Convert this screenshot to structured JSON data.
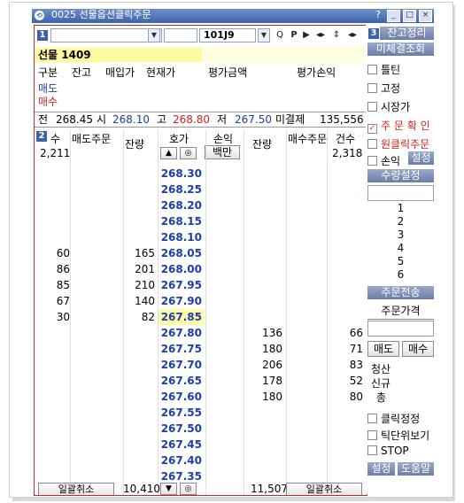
{
  "window": {
    "title": "0025 선물옵션클릭주문",
    "help_icon": "?"
  },
  "toolbar": {
    "panel_number": "1",
    "code": "101J9",
    "search_icon": "Q",
    "p_label": "P"
  },
  "contract": {
    "name": "선물 1409"
  },
  "positions": {
    "headers": [
      "구분",
      "잔고",
      "매입가",
      "현재가",
      "평가금액",
      "평가손익"
    ],
    "rows": [
      "매도",
      "매수"
    ]
  },
  "summary": {
    "open_label": "전",
    "open": "268.45",
    "start_label": "시",
    "start": "268.10",
    "high_label": "고",
    "high": "268.80",
    "low_label": "저",
    "low": "267.50",
    "oi_label": "미결제",
    "oi": "135,556"
  },
  "ladder_header": {
    "panel_number": "2",
    "count_label": "수",
    "sell_order_label": "매도주문",
    "sell_qty_label": "잔량",
    "price_label": "호가",
    "pl_label": "손익",
    "pl_btn": "백만",
    "buy_qty_label": "잔량",
    "buy_order_label": "매수주문",
    "buy_count_label": "건수",
    "sell_count_total": "2,211",
    "buy_count_total": "2,318",
    "up_arrow": "▲",
    "center_btn": "◎"
  },
  "ladder": [
    {
      "count": "",
      "qty": "",
      "price": "268.30",
      "bqty": "",
      "bcount": ""
    },
    {
      "count": "",
      "qty": "",
      "price": "268.25",
      "bqty": "",
      "bcount": ""
    },
    {
      "count": "",
      "qty": "",
      "price": "268.20",
      "bqty": "",
      "bcount": ""
    },
    {
      "count": "",
      "qty": "",
      "price": "268.15",
      "bqty": "",
      "bcount": ""
    },
    {
      "count": "",
      "qty": "",
      "price": "268.10",
      "bqty": "",
      "bcount": ""
    },
    {
      "count": "60",
      "qty": "165",
      "price": "268.05",
      "bqty": "",
      "bcount": ""
    },
    {
      "count": "86",
      "qty": "201",
      "price": "268.00",
      "bqty": "",
      "bcount": ""
    },
    {
      "count": "85",
      "qty": "210",
      "price": "267.95",
      "bqty": "",
      "bcount": ""
    },
    {
      "count": "67",
      "qty": "140",
      "price": "267.90",
      "bqty": "",
      "bcount": ""
    },
    {
      "count": "30",
      "qty": "82",
      "price": "267.85",
      "bqty": "",
      "bcount": ""
    },
    {
      "count": "",
      "qty": "",
      "price": "267.80",
      "bqty": "136",
      "bcount": "66"
    },
    {
      "count": "",
      "qty": "",
      "price": "267.75",
      "bqty": "180",
      "bcount": "71"
    },
    {
      "count": "",
      "qty": "",
      "price": "267.70",
      "bqty": "206",
      "bcount": "83"
    },
    {
      "count": "",
      "qty": "",
      "price": "267.65",
      "bqty": "178",
      "bcount": "52"
    },
    {
      "count": "",
      "qty": "",
      "price": "267.60",
      "bqty": "180",
      "bcount": "80"
    },
    {
      "count": "",
      "qty": "",
      "price": "267.55",
      "bqty": "",
      "bcount": ""
    },
    {
      "count": "",
      "qty": "",
      "price": "267.50",
      "bqty": "",
      "bcount": ""
    },
    {
      "count": "",
      "qty": "",
      "price": "267.45",
      "bqty": "",
      "bcount": ""
    },
    {
      "count": "",
      "qty": "",
      "price": "267.40",
      "bqty": "",
      "bcount": ""
    },
    {
      "count": "",
      "qty": "",
      "price": "267.35",
      "bqty": "",
      "bcount": ""
    }
  ],
  "footer": {
    "sell_all_btn": "일괄취소",
    "sell_total": "10,410",
    "down_arrow": "▼",
    "center_btn": "◎",
    "buy_total": "11,507",
    "buy_all_btn": "일괄취소"
  },
  "right_panel": {
    "panel_number": "3",
    "balance_btn": "잔고정리",
    "unfilled_btn": "미체결조회",
    "options": [
      {
        "label": "틀틴",
        "checked": false
      },
      {
        "label": "고정",
        "checked": false
      },
      {
        "label": "시장가",
        "checked": false
      },
      {
        "label": "주 문 확 인",
        "checked": true
      },
      {
        "label": "원클릭주문",
        "checked": false
      },
      {
        "label": "손익",
        "checked": false
      }
    ],
    "settings_small": "설정",
    "qty_setting_btn": "수량설정",
    "qty_values": [
      "1",
      "2",
      "3",
      "4",
      "5",
      "6"
    ],
    "order_send_btn": "주문전송",
    "order_price_label": "주문가격",
    "sell_btn": "매도",
    "buy_btn": "매수",
    "clear_label": "청산",
    "new_label": "신규",
    "total_label": "총",
    "bottom_options": [
      {
        "label": "클릭정정",
        "checked": false
      },
      {
        "label": "틱단위보기",
        "checked": false
      },
      {
        "label": "STOP",
        "checked": false
      }
    ],
    "settings_btn": "설정",
    "help_btn": "도움말"
  }
}
